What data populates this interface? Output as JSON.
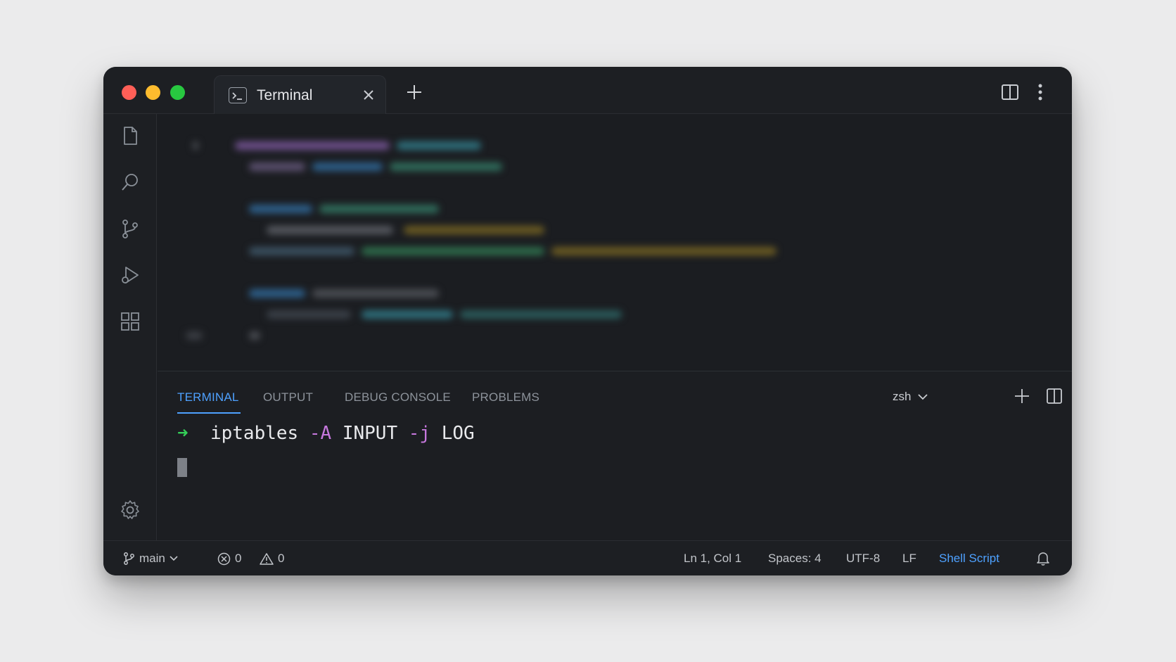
{
  "window": {
    "tab_title": "Terminal"
  },
  "activity_bar": {
    "icons": [
      "files-icon",
      "search-icon",
      "source-control-icon",
      "run-debug-icon",
      "extensions-icon",
      "settings-gear-icon"
    ]
  },
  "panel": {
    "tabs": [
      {
        "label": "TERMINAL",
        "active": true
      },
      {
        "label": "OUTPUT",
        "active": false
      },
      {
        "label": "DEBUG CONSOLE",
        "active": false
      },
      {
        "label": "PROBLEMS",
        "active": false
      }
    ],
    "shell": "zsh",
    "terminal": {
      "prompt": "➜",
      "command": "iptables",
      "arg1_flag": "-A",
      "arg1_value": "INPUT",
      "arg2_flag": "-j",
      "arg2_value": "LOG"
    }
  },
  "status_bar": {
    "branch": "main",
    "errors": "0",
    "warnings": "0",
    "cursor_position": "Ln 1, Col 1",
    "indentation": "Spaces: 4",
    "encoding": "UTF-8",
    "line_ending": "LF",
    "language": "Shell Script"
  },
  "colors": {
    "accent": "#4ea1ff",
    "prompt_arrow": "#34d058",
    "flag": "#c678dd",
    "close": "#ff5f57",
    "minimize": "#febc2e",
    "maximize": "#28c840"
  }
}
